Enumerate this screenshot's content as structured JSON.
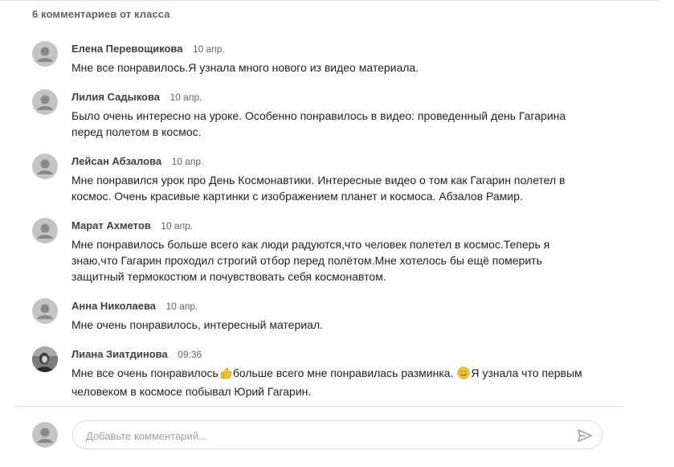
{
  "header": {
    "title": "6 комментариев от класса"
  },
  "comments": [
    {
      "author": "Елена Перевощикова",
      "time": "10 апр.",
      "text": "Мне все понравилось.Я узнала много нового из видео материала."
    },
    {
      "author": "Лилия Садыкова",
      "time": "10 апр.",
      "text": "Было очень интересно на уроке. Особенно понравилось в видео: проведенный день Гагарина\nперед полетом в космос."
    },
    {
      "author": "Лейсан Абзалова",
      "time": "10 апр.",
      "text": "Мне понравился урок про День Космонавтики. Интересные видео о том как Гагарин полетел в\nкосмос. Очень красивые картинки с изображением планет и космоса. Абзалов Рамир."
    },
    {
      "author": "Марат Ахметов",
      "time": "10 апр.",
      "text": "Мне понравилось больше всего как люди радуются,что человек полетел в космос.Теперь я\nзнаю,что Гагарин проходил строгий отбор перед полётом.Мне хотелось бы ещё померить\nзащитный термокостюм и почувствовать себя космонавтом."
    },
    {
      "author": "Анна Николаева",
      "time": "10 апр.",
      "text": "Мне очень понравилось, интересный материал."
    },
    {
      "author": "Лиана Зиатдинова",
      "time": "09:36",
      "text_part1": "Мне все очень понравилось",
      "text_part2": "больше всего мне понравилась разминка. ",
      "text_part3": "Я узнала что первым\nчеловеком в космосе побывал Юрий Гагарин.",
      "emoji1": "thumbs-up-emoji",
      "emoji2": "smiling-face-emoji"
    }
  ],
  "compose": {
    "placeholder": "Добавьте комментарий...",
    "send_icon": "send-icon"
  },
  "colors": {
    "avatar_gray": "#c4c4c4",
    "text": "#202124",
    "muted": "#5f6368",
    "emoji_yellow": "#f7c531"
  }
}
